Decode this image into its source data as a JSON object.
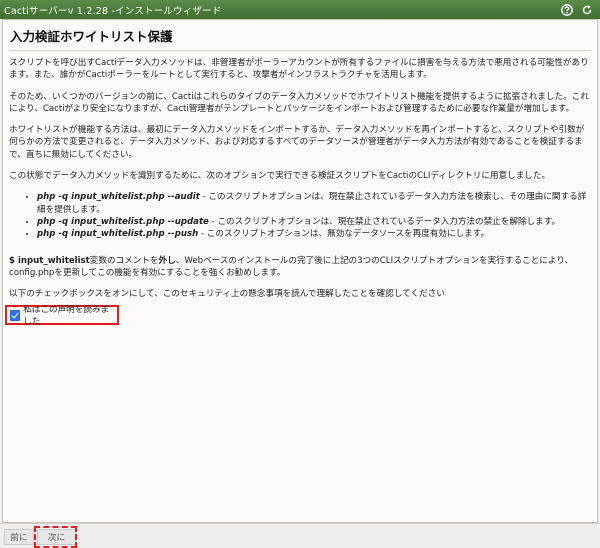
{
  "window": {
    "title": "Cactiサーバーv 1.2.28 -インストールウィザード",
    "help_icon": "help-icon",
    "refresh_icon": "refresh-icon"
  },
  "page": {
    "heading": "入力検証ホワイトリスト保護",
    "para1": "スクリプトを呼び出すCactiデータ入力メソッドは、非管理者がポーラーアカウントが所有するファイルに損害を与える方法で悪用される可能性があります。また、誰かがCactiポーラーをルートとして実行すると、攻撃者がインフラストラクチャを活用します。",
    "para2": "そのため、いくつかのバージョンの前に、Cactiはこれらのタイプのデータ入力メソッドでホワイトリスト機能を提供するように拡張されました。これにより、Cactiがより安全になりますが、Cacti管理者がテンプレートとパッケージをインポートおよび管理するために必要な作業量が増加します。",
    "para3": "ホワイトリストが機能する方法は、最初にデータ入力メソッドをインポートするか、データ入力メソッドを再インポートすると、スクリプトや引数が何らかの方法で変更されると、データ入力メソッド、および対応するすべてのデータソースが管理者がデータ入力方法が有効であることを検証するまで、直ちに無効にしてください。",
    "para4": "この状態でデータ入力メソッドを識別するために、次のオプションで実行できる検証スクリプトをCactiのCLIディレクトリに用意しました。",
    "options": [
      {
        "cmd": "php -q input_whitelist.php --audit",
        "desc": " - このスクリプトオプションは、現在禁止されているデータ入力方法を検索し、その理由に関する詳細を提供します。"
      },
      {
        "cmd": "php -q input_whitelist.php --update",
        "desc": " - このスクリプトオプションは、現在禁止されているデータ入力方法の禁止を解除します。"
      },
      {
        "cmd": "php -q input_whitelist.php --push",
        "desc": " - このスクリプトオプションは、無効なデータソースを再度有効にします。"
      }
    ],
    "para5_prefix": "$ input_whitelist",
    "para5_mid": "変数のコメントを",
    "para5_bold": "外し",
    "para5_suffix": "、Webベースのインストールの完了後に上記の3つのCLIスクリプトオプションを実行することにより、config.phpを更新してこの機能を有効にすることを強くお勧めします。",
    "para6": "以下のチェックボックスをオンにして、このセキュリティ上の懸念事項を読んで理解したことを確認してください",
    "checkbox_label": "私はこの声明を読みました",
    "checkbox_checked": true
  },
  "footer": {
    "prev_label": "前に",
    "next_label": "次に"
  },
  "colors": {
    "titlebar": "#4a7a3a",
    "highlight": "#e02020",
    "checkbox": "#2f73e0"
  }
}
